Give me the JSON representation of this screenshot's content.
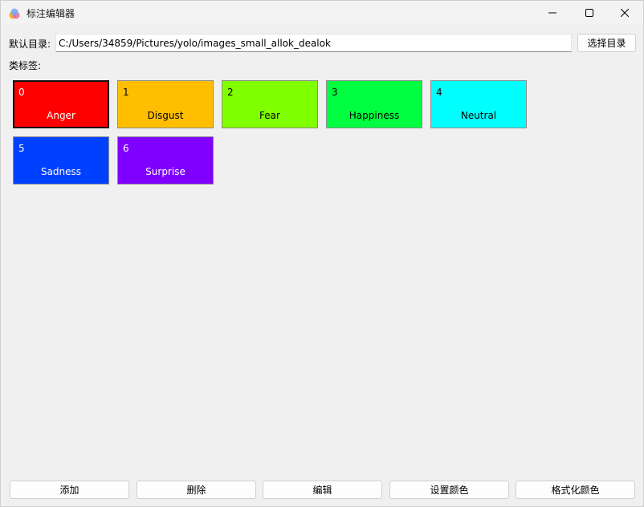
{
  "window": {
    "title": "标注编辑器"
  },
  "directory": {
    "label": "默认目录:",
    "value": "C:/Users/34859/Pictures/yolo/images_small_allok_dealok",
    "choose_button": "选择目录"
  },
  "labels_caption": "类标签:",
  "tags": [
    {
      "id": "0",
      "name": "Anger",
      "color": "#ff0000",
      "text_color": "#ffffff",
      "selected": true
    },
    {
      "id": "1",
      "name": "Disgust",
      "color": "#ffbf00",
      "text_color": "#000000",
      "selected": false
    },
    {
      "id": "2",
      "name": "Fear",
      "color": "#80ff00",
      "text_color": "#000000",
      "selected": false
    },
    {
      "id": "3",
      "name": "Happiness",
      "color": "#00ff40",
      "text_color": "#000000",
      "selected": false
    },
    {
      "id": "4",
      "name": "Neutral",
      "color": "#00ffff",
      "text_color": "#000000",
      "selected": false
    },
    {
      "id": "5",
      "name": "Sadness",
      "color": "#0040ff",
      "text_color": "#ffffff",
      "selected": false
    },
    {
      "id": "6",
      "name": "Surprise",
      "color": "#8000ff",
      "text_color": "#ffffff",
      "selected": false
    }
  ],
  "buttons": {
    "add": "添加",
    "delete": "删除",
    "edit": "编辑",
    "set_color": "设置颜色",
    "format_color": "格式化颜色"
  }
}
